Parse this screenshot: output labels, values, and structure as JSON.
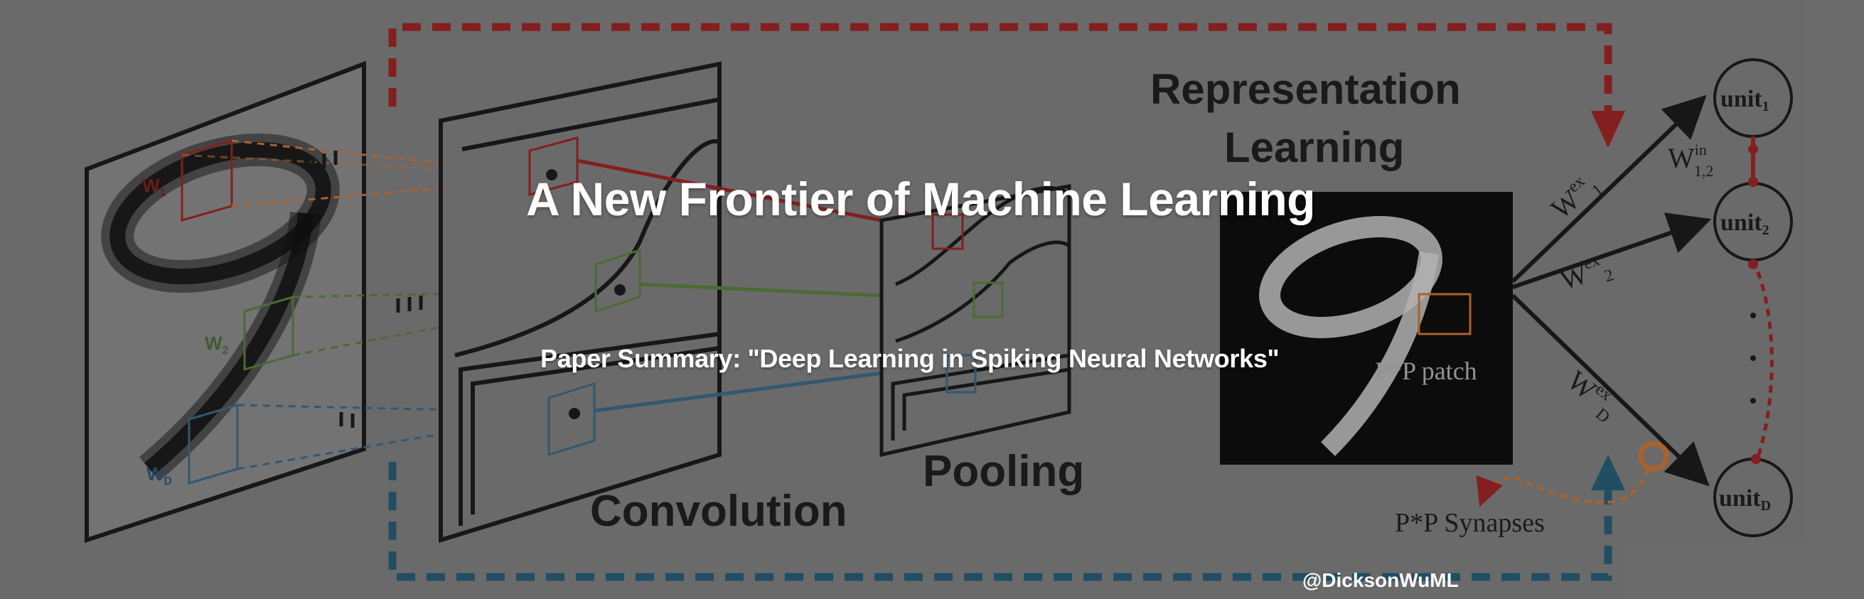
{
  "banner": {
    "title": "A New Frontier of Machine Learning",
    "subtitle": "Paper Summary: \"Deep Learning in Spiking Neural Networks\"",
    "handle": "@DicksonWuML"
  },
  "diagram": {
    "section_labels": {
      "convolution": "Convolution",
      "pooling": "Pooling",
      "representation_line1": "Representation",
      "representation_line2": "Learning"
    },
    "kernel_labels": {
      "w1": "W",
      "w1_sub": "1",
      "w2": "W",
      "w2_sub": "2",
      "wd": "W",
      "wd_sub": "D"
    },
    "patch_label": "P*P patch",
    "synapses_label": "P*P Synapses",
    "units": [
      {
        "label": "unit",
        "sub": "1"
      },
      {
        "label": "unit",
        "sub": "2"
      },
      {
        "label": "unit",
        "sub": "D"
      }
    ],
    "weights": {
      "w_ex_1": {
        "base": "W",
        "sup": "ex",
        "sub": "1"
      },
      "w_ex_2": {
        "base": "W",
        "sup": "ex",
        "sub": "2"
      },
      "w_ex_d": {
        "base": "W",
        "sup": "ex",
        "sub": "D"
      },
      "w_in_12": {
        "base": "W",
        "sup": "in",
        "sub": "1,2"
      }
    },
    "colors": {
      "background": "#6e6e6e",
      "red_path": "#8a1a1a",
      "blue_path": "#1d4f66",
      "green": "#4b6e32",
      "orange": "#b5652a",
      "line": "#111111"
    }
  }
}
